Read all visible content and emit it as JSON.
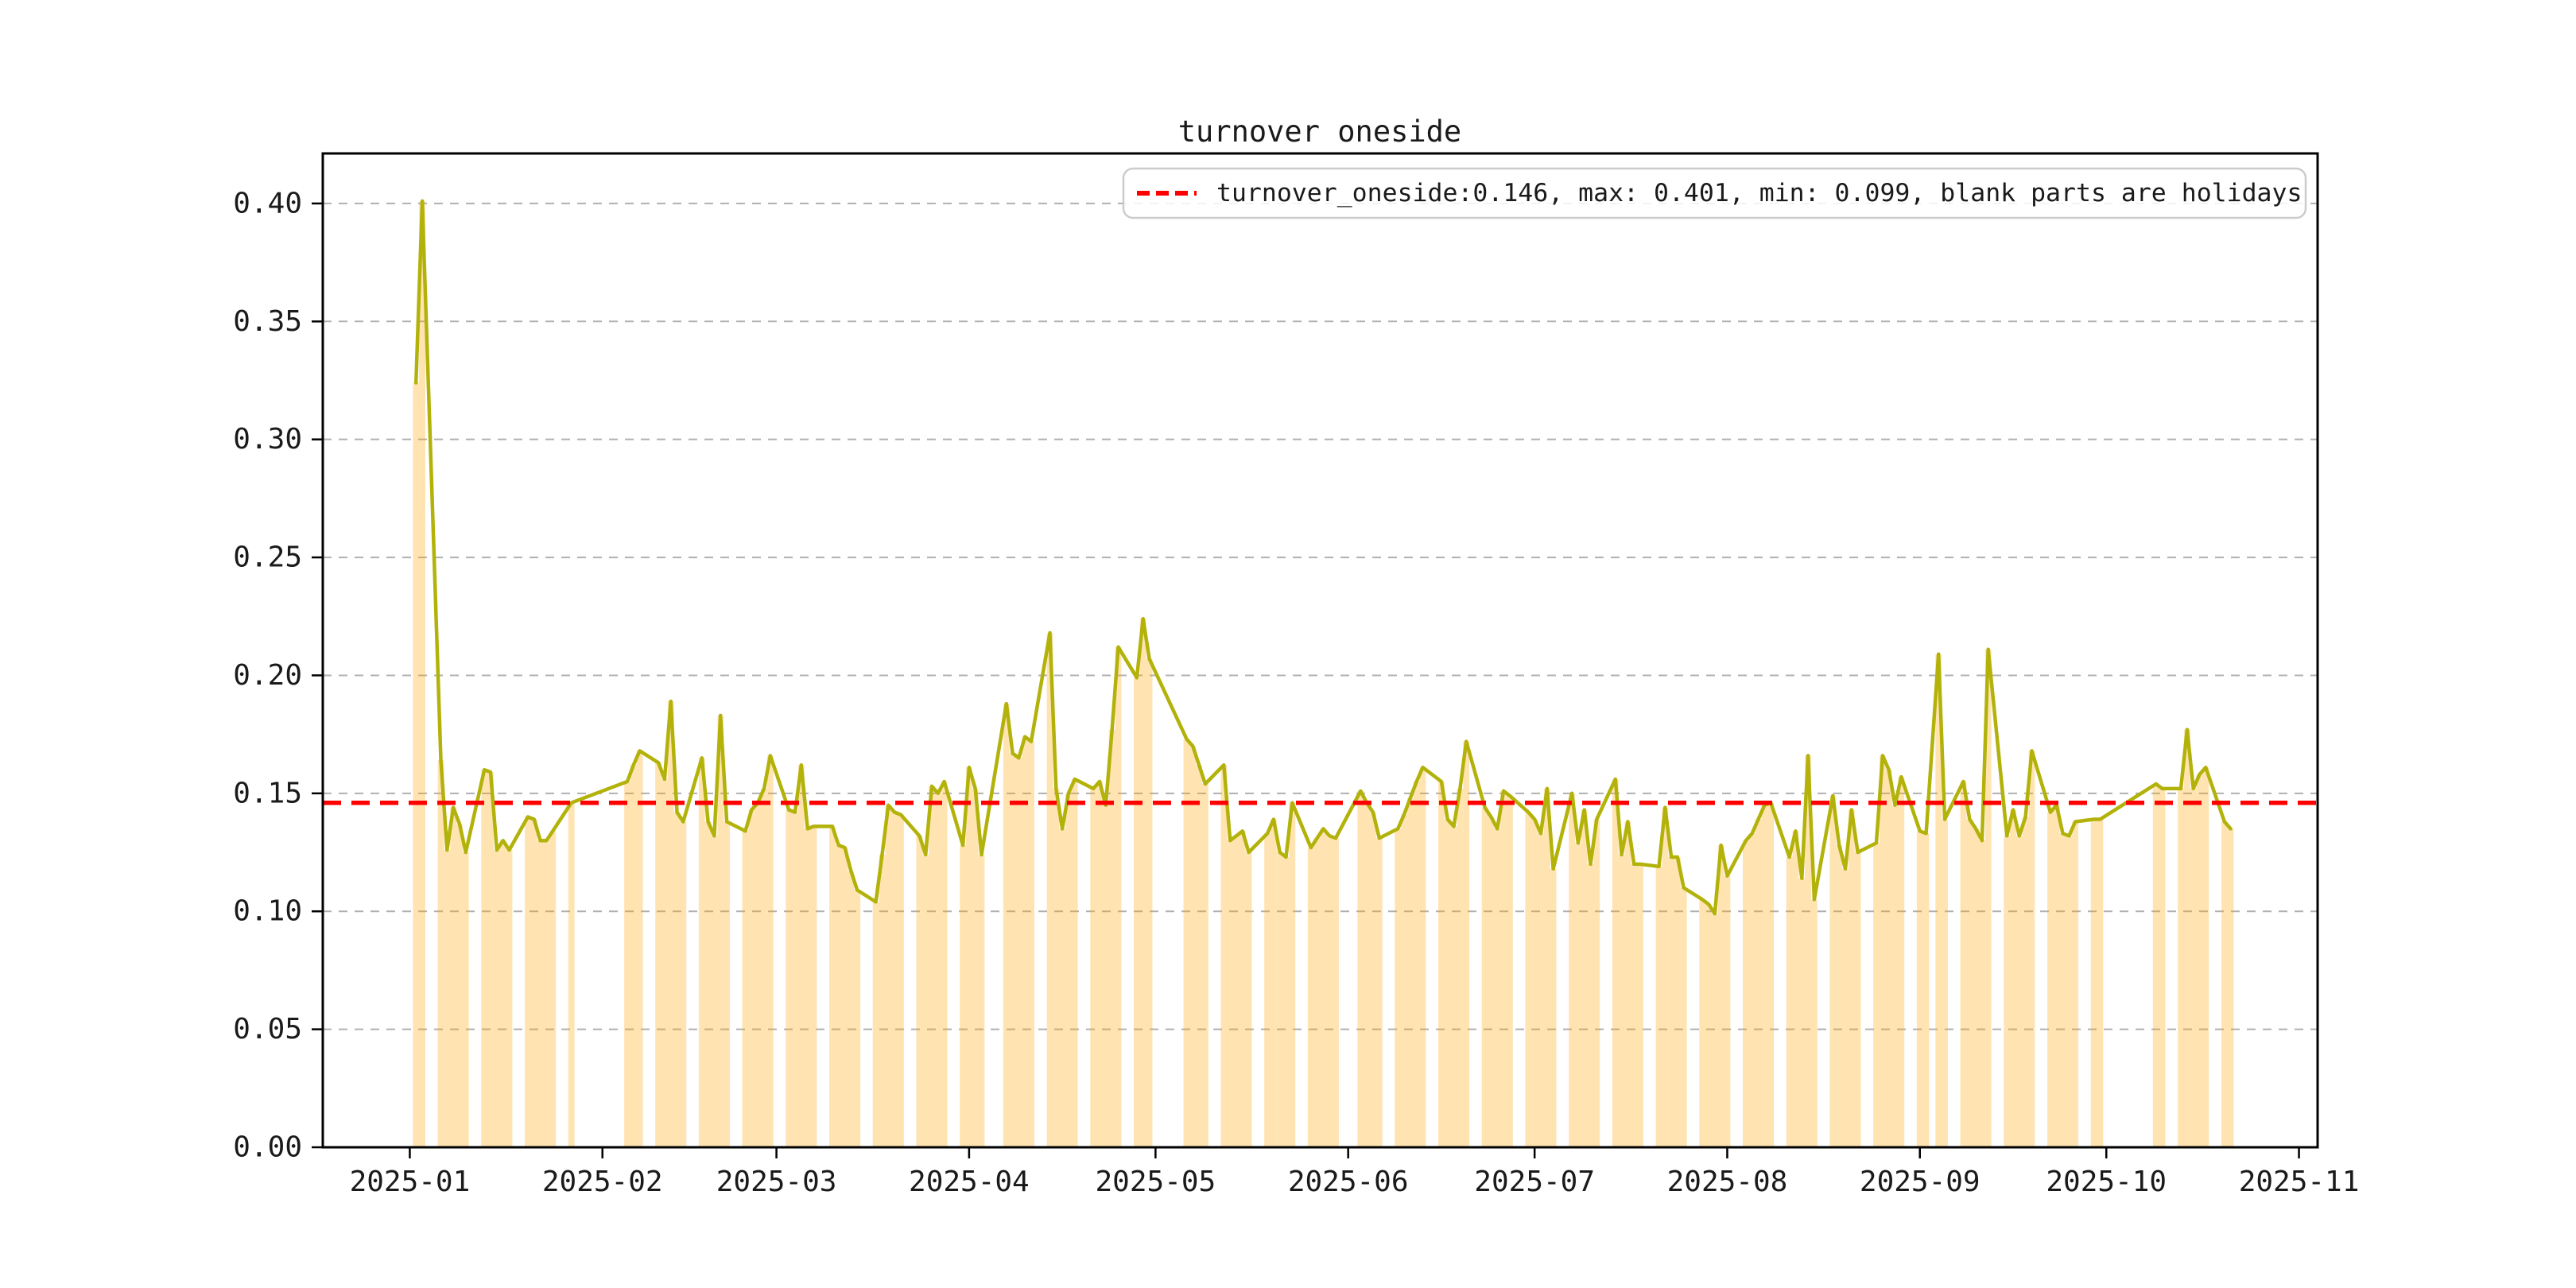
{
  "figure": {
    "title": "turnover oneside",
    "background": "#ffffff"
  },
  "chart_data": {
    "type": "line",
    "title": "turnover oneside",
    "xlabel": "",
    "ylabel": "",
    "grid": true,
    "legend": {
      "position": "upper right",
      "marker": "red-dashed-line",
      "label": "turnover_oneside:0.146, max: 0.401, min: 0.099, blank parts are holidays"
    },
    "stats": {
      "mean": 0.146,
      "max": 0.401,
      "min": 0.099
    },
    "mean_line": {
      "value": 0.146,
      "style": "dashed",
      "color": "#ff0000"
    },
    "holiday_note": "blank parts are holidays",
    "ylim": [
      0.0,
      0.4212
    ],
    "xlim": [
      "2024-12-18",
      "2025-11-04"
    ],
    "y_ticks": [
      "0.00",
      "0.05",
      "0.10",
      "0.15",
      "0.20",
      "0.25",
      "0.30",
      "0.35",
      "0.40"
    ],
    "y_tick_values": [
      0.0,
      0.05,
      0.1,
      0.15,
      0.2,
      0.25,
      0.3,
      0.35,
      0.4
    ],
    "x_ticks": [
      "2025-01",
      "2025-02",
      "2025-03",
      "2025-04",
      "2025-05",
      "2025-06",
      "2025-07",
      "2025-08",
      "2025-09",
      "2025-10",
      "2025-11"
    ],
    "colors": {
      "line": "#b2b20a",
      "day_fill": "#ffa500",
      "day_fill_opacity": 0.3,
      "mean_line": "#ff0000",
      "grid": "#b0b0b0",
      "spine": "#000000",
      "legend_border": "#cccccc"
    },
    "series_name": "turnover_oneside",
    "dates": [
      "2025-01-02",
      "2025-01-03",
      "2025-01-06",
      "2025-01-07",
      "2025-01-08",
      "2025-01-09",
      "2025-01-10",
      "2025-01-13",
      "2025-01-14",
      "2025-01-15",
      "2025-01-16",
      "2025-01-17",
      "2025-01-20",
      "2025-01-21",
      "2025-01-22",
      "2025-01-23",
      "2025-01-24",
      "2025-01-27",
      "2025-02-05",
      "2025-02-06",
      "2025-02-07",
      "2025-02-10",
      "2025-02-11",
      "2025-02-12",
      "2025-02-13",
      "2025-02-14",
      "2025-02-17",
      "2025-02-18",
      "2025-02-19",
      "2025-02-20",
      "2025-02-21",
      "2025-02-24",
      "2025-02-25",
      "2025-02-26",
      "2025-02-27",
      "2025-02-28",
      "2025-03-03",
      "2025-03-04",
      "2025-03-05",
      "2025-03-06",
      "2025-03-07",
      "2025-03-10",
      "2025-03-11",
      "2025-03-12",
      "2025-03-13",
      "2025-03-14",
      "2025-03-17",
      "2025-03-18",
      "2025-03-19",
      "2025-03-20",
      "2025-03-21",
      "2025-03-24",
      "2025-03-25",
      "2025-03-26",
      "2025-03-27",
      "2025-03-28",
      "2025-03-31",
      "2025-04-01",
      "2025-04-02",
      "2025-04-03",
      "2025-04-07",
      "2025-04-08",
      "2025-04-09",
      "2025-04-10",
      "2025-04-11",
      "2025-04-14",
      "2025-04-15",
      "2025-04-16",
      "2025-04-17",
      "2025-04-18",
      "2025-04-21",
      "2025-04-22",
      "2025-04-23",
      "2025-04-24",
      "2025-04-25",
      "2025-04-28",
      "2025-04-29",
      "2025-04-30",
      "2025-05-06",
      "2025-05-07",
      "2025-05-08",
      "2025-05-09",
      "2025-05-12",
      "2025-05-13",
      "2025-05-14",
      "2025-05-15",
      "2025-05-16",
      "2025-05-19",
      "2025-05-20",
      "2025-05-21",
      "2025-05-22",
      "2025-05-23",
      "2025-05-26",
      "2025-05-27",
      "2025-05-28",
      "2025-05-29",
      "2025-05-30",
      "2025-06-03",
      "2025-06-04",
      "2025-06-05",
      "2025-06-06",
      "2025-06-09",
      "2025-06-10",
      "2025-06-11",
      "2025-06-12",
      "2025-06-13",
      "2025-06-16",
      "2025-06-17",
      "2025-06-18",
      "2025-06-19",
      "2025-06-20",
      "2025-06-23",
      "2025-06-24",
      "2025-06-25",
      "2025-06-26",
      "2025-06-27",
      "2025-06-30",
      "2025-07-01",
      "2025-07-02",
      "2025-07-03",
      "2025-07-04",
      "2025-07-07",
      "2025-07-08",
      "2025-07-09",
      "2025-07-10",
      "2025-07-11",
      "2025-07-14",
      "2025-07-15",
      "2025-07-16",
      "2025-07-17",
      "2025-07-18",
      "2025-07-21",
      "2025-07-22",
      "2025-07-23",
      "2025-07-24",
      "2025-07-25",
      "2025-07-28",
      "2025-07-29",
      "2025-07-30",
      "2025-07-31",
      "2025-08-01",
      "2025-08-04",
      "2025-08-05",
      "2025-08-06",
      "2025-08-07",
      "2025-08-08",
      "2025-08-11",
      "2025-08-12",
      "2025-08-13",
      "2025-08-14",
      "2025-08-15",
      "2025-08-18",
      "2025-08-19",
      "2025-08-20",
      "2025-08-21",
      "2025-08-22",
      "2025-08-25",
      "2025-08-26",
      "2025-08-27",
      "2025-08-28",
      "2025-08-29",
      "2025-09-01",
      "2025-09-02",
      "2025-09-04",
      "2025-09-05",
      "2025-09-08",
      "2025-09-09",
      "2025-09-10",
      "2025-09-11",
      "2025-09-12",
      "2025-09-15",
      "2025-09-16",
      "2025-09-17",
      "2025-09-18",
      "2025-09-19",
      "2025-09-22",
      "2025-09-23",
      "2025-09-24",
      "2025-09-25",
      "2025-09-26",
      "2025-09-29",
      "2025-09-30",
      "2025-10-09",
      "2025-10-10",
      "2025-10-13",
      "2025-10-14",
      "2025-10-15",
      "2025-10-16",
      "2025-10-17",
      "2025-10-20",
      "2025-10-21"
    ],
    "values": [
      0.324,
      0.401,
      0.164,
      0.126,
      0.144,
      0.137,
      0.125,
      0.16,
      0.159,
      0.126,
      0.13,
      0.126,
      0.14,
      0.139,
      0.13,
      0.13,
      0.134,
      0.146,
      0.155,
      0.162,
      0.168,
      0.163,
      0.156,
      0.189,
      0.142,
      0.138,
      0.165,
      0.138,
      0.132,
      0.183,
      0.138,
      0.134,
      0.143,
      0.146,
      0.152,
      0.166,
      0.143,
      0.142,
      0.162,
      0.135,
      0.136,
      0.136,
      0.128,
      0.127,
      0.117,
      0.109,
      0.104,
      0.124,
      0.145,
      0.142,
      0.141,
      0.132,
      0.124,
      0.153,
      0.15,
      0.155,
      0.128,
      0.161,
      0.152,
      0.124,
      0.188,
      0.167,
      0.165,
      0.174,
      0.172,
      0.218,
      0.152,
      0.135,
      0.15,
      0.156,
      0.152,
      0.155,
      0.145,
      0.177,
      0.212,
      0.199,
      0.224,
      0.207,
      0.173,
      0.17,
      0.162,
      0.154,
      0.162,
      0.13,
      0.132,
      0.134,
      0.125,
      0.133,
      0.139,
      0.125,
      0.123,
      0.146,
      0.127,
      0.131,
      0.135,
      0.132,
      0.131,
      0.151,
      0.146,
      0.142,
      0.131,
      0.135,
      0.141,
      0.148,
      0.155,
      0.161,
      0.155,
      0.139,
      0.136,
      0.152,
      0.172,
      0.144,
      0.14,
      0.135,
      0.151,
      0.149,
      0.142,
      0.139,
      0.133,
      0.152,
      0.118,
      0.15,
      0.129,
      0.143,
      0.12,
      0.139,
      0.156,
      0.124,
      0.138,
      0.12,
      0.12,
      0.119,
      0.144,
      0.123,
      0.123,
      0.11,
      0.105,
      0.103,
      0.099,
      0.128,
      0.115,
      0.13,
      0.133,
      0.139,
      0.145,
      0.146,
      0.123,
      0.134,
      0.114,
      0.166,
      0.105,
      0.149,
      0.128,
      0.118,
      0.143,
      0.125,
      0.129,
      0.166,
      0.16,
      0.145,
      0.157,
      0.134,
      0.133,
      0.209,
      0.139,
      0.155,
      0.139,
      0.135,
      0.13,
      0.211,
      0.132,
      0.143,
      0.132,
      0.14,
      0.168,
      0.142,
      0.145,
      0.133,
      0.132,
      0.138,
      0.139,
      0.139,
      0.154,
      0.152,
      0.152,
      0.177,
      0.152,
      0.158,
      0.161,
      0.138,
      0.135
    ]
  }
}
